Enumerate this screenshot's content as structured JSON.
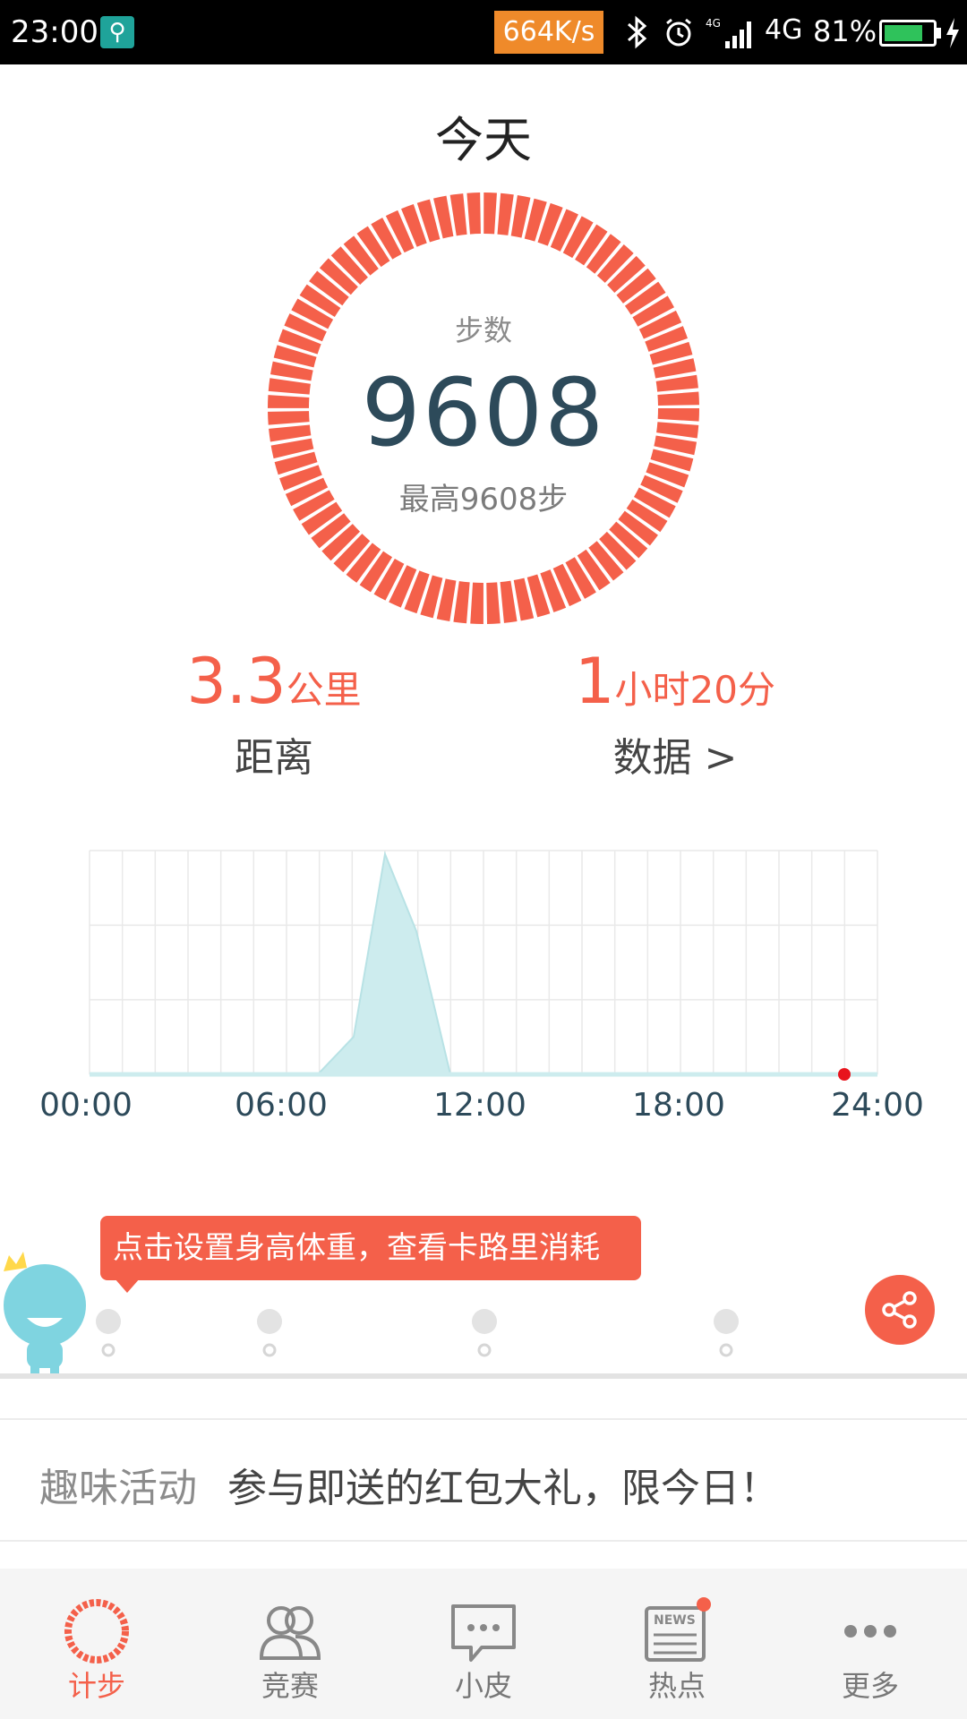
{
  "status_bar": {
    "time": "23:00",
    "network_speed": "664K/s",
    "network_type": "4G",
    "battery": "81%",
    "battery_fraction": 0.81
  },
  "header": {
    "title": "今天"
  },
  "steps": {
    "label": "步数",
    "value": "9608",
    "best": "最高9608步",
    "ring_color": "#f4604a"
  },
  "stats": {
    "distance_value": "3.3",
    "distance_unit": "公里",
    "distance_label": "距离",
    "duration_hours": "1",
    "duration_rest": "小时20分",
    "data_label": "数据 >"
  },
  "chart_data": {
    "type": "area",
    "x_ticks": [
      "00:00",
      "06:00",
      "12:00",
      "18:00",
      "24:00"
    ],
    "fill_color": "#cdecee",
    "current_marker_color": "#e8141c"
  },
  "tooltip": {
    "text": "点击设置身高体重，查看卡路里消耗"
  },
  "activity": {
    "tag": "趣味活动",
    "text": "参与即送的红包大礼，限今日！"
  },
  "tabbar": {
    "items": [
      {
        "label": "计步",
        "icon": "pedometer-icon",
        "active": true
      },
      {
        "label": "竞赛",
        "icon": "people-icon",
        "active": false
      },
      {
        "label": "小皮",
        "icon": "chat-icon",
        "active": false
      },
      {
        "label": "热点",
        "icon": "news-icon",
        "active": false,
        "badge": true
      },
      {
        "label": "更多",
        "icon": "more-icon",
        "active": false
      }
    ]
  }
}
